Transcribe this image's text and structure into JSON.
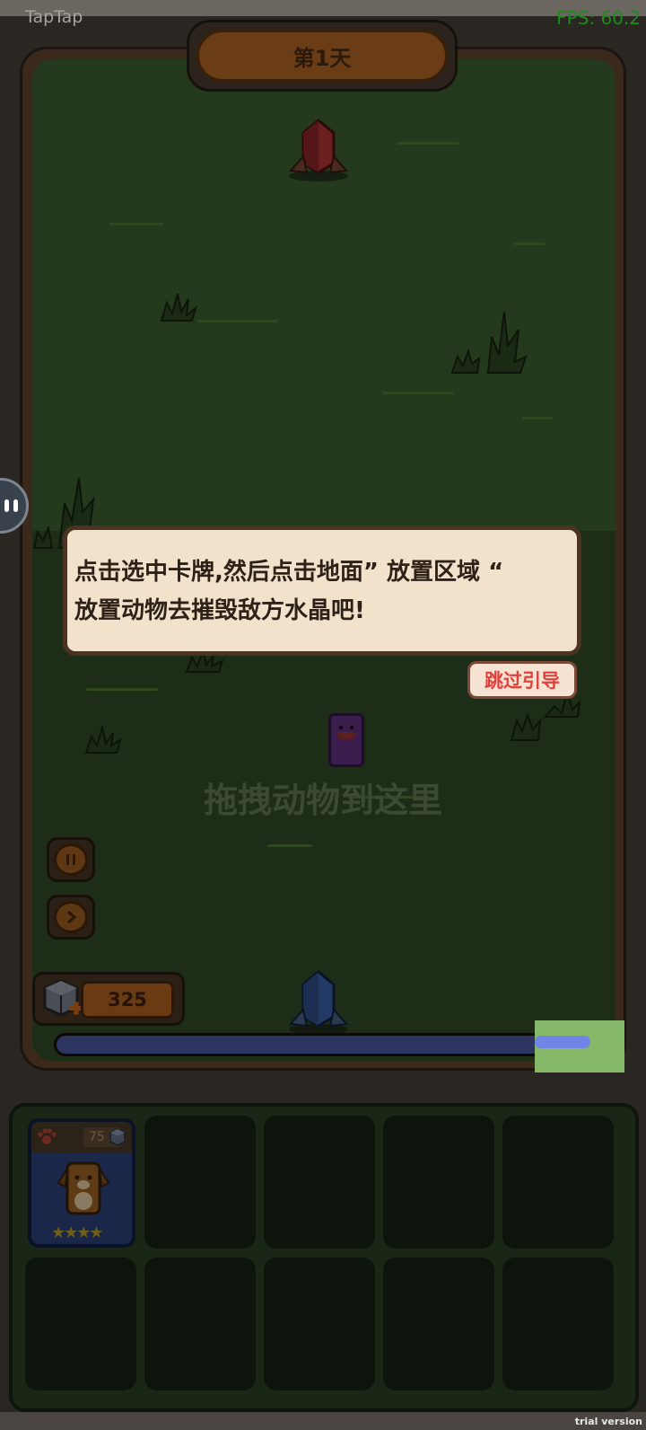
{
  "status_bar": {
    "app_label": "TapTap",
    "fps": "FPS: 60.2"
  },
  "day_banner": {
    "label": "第1天"
  },
  "tutorial": {
    "line1": "点击选中卡牌,然后点击地面” 放置区域 “",
    "line2": "放置动物去摧毁敌方水晶吧!",
    "skip_label": "跳过引导"
  },
  "field": {
    "drop_hint": "拖拽动物到这里"
  },
  "controls": {
    "pause_icon": "pause-icon",
    "speed_icon": "play-forward-icon"
  },
  "resources": {
    "crystal_count": "325",
    "icon": "crystal-cube-plus-icon"
  },
  "progress": {
    "fill_fraction": 0.96
  },
  "card_slots": [
    {
      "empty": false,
      "cost": "75",
      "animal": "dog",
      "stars": "★★★★",
      "stars_count": 4
    },
    {
      "empty": true
    },
    {
      "empty": true
    },
    {
      "empty": true
    },
    {
      "empty": true
    },
    {
      "empty": true
    },
    {
      "empty": true
    },
    {
      "empty": true
    },
    {
      "empty": true
    },
    {
      "empty": true
    }
  ],
  "colors": {
    "enemy_crystal": "#6b1f1f",
    "player_crystal": "#243a66",
    "skip_text": "#e0413a",
    "fps_text": "#1f8a1f"
  },
  "footer": {
    "watermark": "trial version"
  }
}
